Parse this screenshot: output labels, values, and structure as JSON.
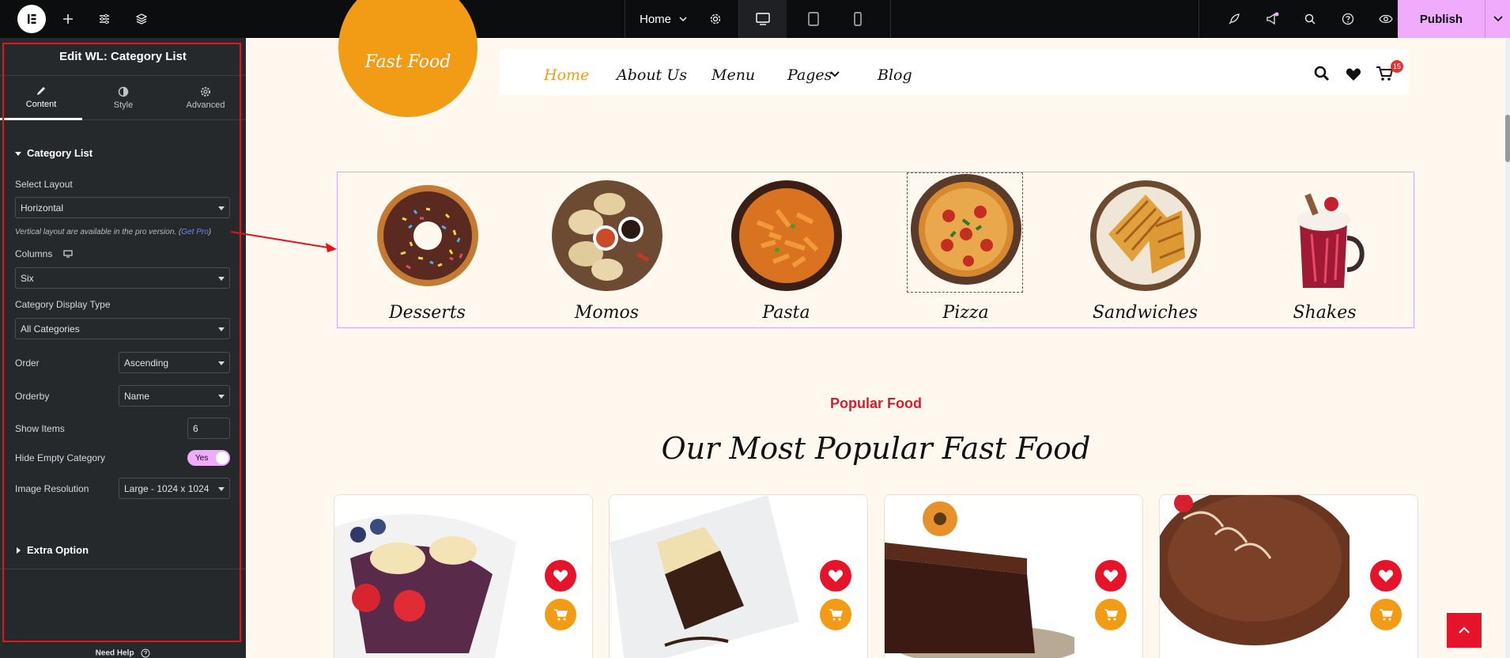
{
  "topbar": {
    "page_name": "Home",
    "publish_label": "Publish"
  },
  "panel": {
    "title": "Edit WL: Category List",
    "tabs": [
      {
        "label": "Content"
      },
      {
        "label": "Style"
      },
      {
        "label": "Advanced"
      }
    ],
    "section_title": "Category List",
    "select_layout_label": "Select Layout",
    "select_layout_value": "Horizontal",
    "pro_note": "Vertical layout are available in the pro version. (",
    "pro_link": "Get Pro",
    "pro_note_end": ")",
    "columns_label": "Columns",
    "columns_value": "Six",
    "display_type_label": "Category Display Type",
    "display_type_value": "All Categories",
    "order_label": "Order",
    "order_value": "Ascending",
    "orderby_label": "Orderby",
    "orderby_value": "Name",
    "show_items_label": "Show Items",
    "show_items_value": "6",
    "hide_empty_label": "Hide Empty Category",
    "hide_empty_value": "Yes",
    "image_res_label": "Image Resolution",
    "image_res_value": "Large - 1024 x 1024",
    "extra_option_label": "Extra Option",
    "need_help": "Need Help"
  },
  "site": {
    "brand": "Fast Food",
    "nav": [
      "Home",
      "About Us",
      "Menu",
      "Pages",
      "Blog"
    ],
    "cart_count": "15",
    "categories": [
      "Desserts",
      "Momos",
      "Pasta",
      "Pizza",
      "Sandwiches",
      "Shakes"
    ],
    "popular_kicker": "Popular Food",
    "popular_title": "Our Most Popular Fast Food"
  },
  "colors": {
    "accent_orange": "#f29c16",
    "publish_pink": "#f0abfc",
    "annotation_red": "#e8101b"
  }
}
